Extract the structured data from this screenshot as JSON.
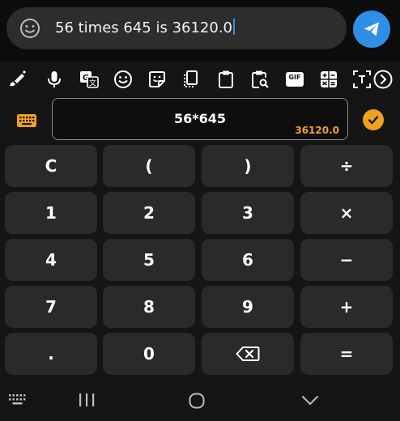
{
  "message": {
    "text": "56 times 645 is 36120.0",
    "emoji_icon": "smiley-icon",
    "send_icon": "send-icon"
  },
  "toolbar": {
    "icons": [
      "pen-icon",
      "mic-icon",
      "translate-icon",
      "emoji-icon",
      "sticker-icon",
      "one-handed-icon",
      "clipboard-icon",
      "clipboard-search-icon",
      "gif-icon",
      "calculator-icon",
      "text-select-icon",
      "chevron-right-icon"
    ],
    "gif_label": "GIF"
  },
  "calculator": {
    "expression": "56*645",
    "result": "36120.0",
    "keys": [
      [
        "C",
        "(",
        ")",
        "÷"
      ],
      [
        "1",
        "2",
        "3",
        "×"
      ],
      [
        "4",
        "5",
        "6",
        "−"
      ],
      [
        "7",
        "8",
        "9",
        "+"
      ],
      [
        ".",
        "0",
        "backspace",
        "="
      ]
    ]
  },
  "colors": {
    "send": "#2f8fe8",
    "accent": "#f0a21d",
    "key": "#2a2a2a",
    "background": "#151515"
  }
}
